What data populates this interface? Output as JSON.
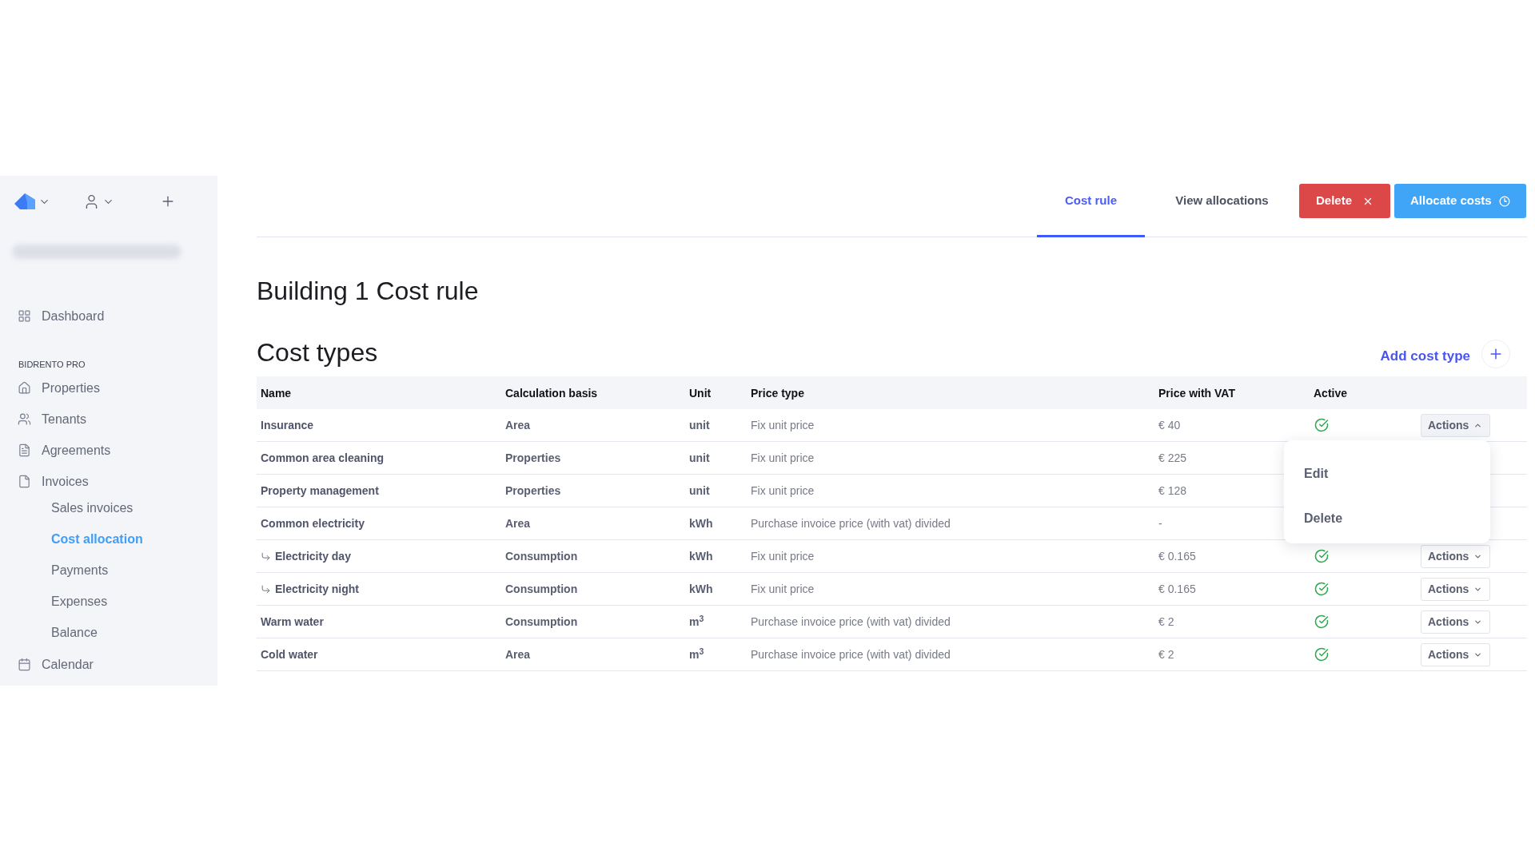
{
  "sidebar": {
    "account_blurred": true,
    "top_items": [
      {
        "label": "Dashboard",
        "selected": false
      }
    ],
    "section_title": "BIDRENTO PRO",
    "items": [
      {
        "label": "Properties",
        "selected": false
      },
      {
        "label": "Tenants",
        "selected": false
      },
      {
        "label": "Agreements",
        "selected": false
      },
      {
        "label": "Invoices",
        "selected": false,
        "children": [
          {
            "label": "Sales invoices",
            "selected": false
          },
          {
            "label": "Cost allocation",
            "selected": true
          },
          {
            "label": "Payments",
            "selected": false
          },
          {
            "label": "Expenses",
            "selected": false
          },
          {
            "label": "Balance",
            "selected": false
          }
        ]
      },
      {
        "label": "Calendar",
        "selected": false
      }
    ]
  },
  "tabs": [
    {
      "label": "Cost rule",
      "selected": true
    },
    {
      "label": "View allocations",
      "selected": false
    }
  ],
  "buttons": [
    {
      "label": "Delete",
      "kind": "danger"
    },
    {
      "label": "Allocate costs",
      "kind": "primary"
    }
  ],
  "title": "Building 1 Cost rule",
  "cost_types": {
    "heading": "Cost types",
    "add_button": "Add cost type",
    "table": {
      "columns": [
        "Name",
        "Calculation basis",
        "Unit",
        "Price type",
        "Price with VAT",
        "Active"
      ],
      "rows": [
        {
          "name": "Insurance",
          "calculation_basis": "Area",
          "unit": "unit",
          "price_type": "Fix unit price",
          "price_with_vat": "€ 40",
          "active": true,
          "actions": {
            "label": "Actions",
            "expanded": true,
            "menu": [
              {
                "label": "Edit"
              },
              {
                "label": "Delete"
              }
            ]
          }
        },
        {
          "name": "Common area cleaning",
          "calculation_basis": "Properties",
          "unit": "unit",
          "price_type": "Fix unit price",
          "price_with_vat": "€ 225"
        },
        {
          "name": "Property management",
          "calculation_basis": "Properties",
          "unit": "unit",
          "price_type": "Fix unit price",
          "price_with_vat": "€ 128"
        },
        {
          "name": "Common electricity",
          "calculation_basis": "Area",
          "unit": "kWh",
          "price_type": "Purchase invoice price (with vat) divided",
          "price_with_vat": "-",
          "children": [
            {
              "name": "Electricity day",
              "calculation_basis": "Consumption",
              "unit": "kWh",
              "price_type": "Fix unit price",
              "price_with_vat": "€ 0.165",
              "active": true,
              "actions": {
                "label": "Actions",
                "expanded": false
              }
            },
            {
              "name": "Electricity night",
              "calculation_basis": "Consumption",
              "unit": "kWh",
              "price_type": "Fix unit price",
              "price_with_vat": "€ 0.165",
              "active": true,
              "actions": {
                "label": "Actions",
                "expanded": false
              }
            }
          ]
        },
        {
          "name": "Warm water",
          "calculation_basis": "Consumption",
          "unit": "m$^{3}$",
          "price_type": "Purchase invoice price (with vat) divided",
          "price_with_vat": "€ 2",
          "active": true,
          "actions": {
            "label": "Actions",
            "expanded": false
          }
        },
        {
          "name": "Cold water",
          "calculation_basis": "Area",
          "unit": "m$^{3}$",
          "price_type": "Purchase invoice price (with vat) divided",
          "price_with_vat": "€ 2",
          "active": true,
          "actions": {
            "label": "Actions",
            "expanded": false
          }
        }
      ]
    }
  }
}
